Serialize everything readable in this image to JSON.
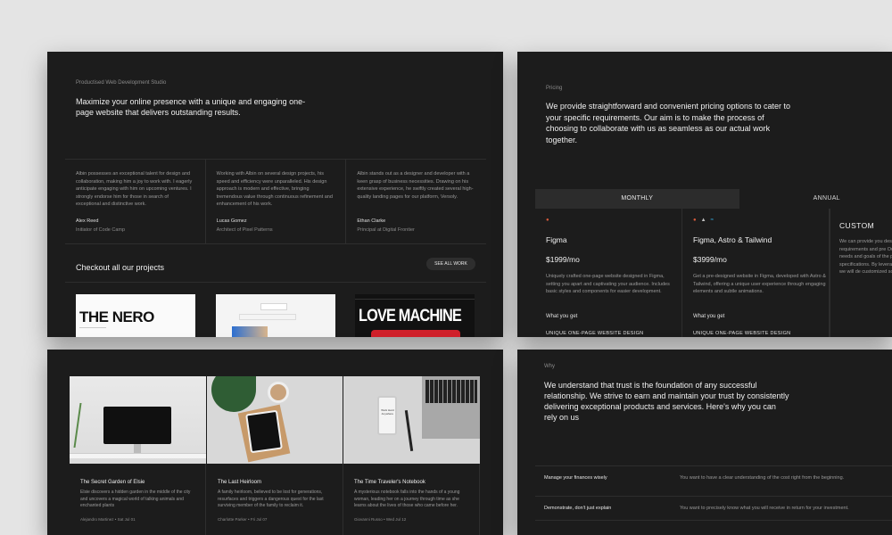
{
  "hero": {
    "eyebrow": "Productised Web Development Studio",
    "headline": "Maximize your online presence with a unique and engaging one-page website that delivers outstanding results."
  },
  "testimonials": [
    {
      "quote": "Albin possesses an exceptional talent for design and collaboration, making him a joy to work with. I eagerly anticipate engaging with him on upcoming ventures. I strongly endorse him for those in search of exceptional and distinctive work.",
      "name": "Alex Reed",
      "role": "Initiator of Code Camp"
    },
    {
      "quote": "Working with Albin on several design projects, his speed and efficiency were unparalleled. His design approach is modern and effective, bringing tremendous value through continuous refinement and enhancement of his work.",
      "name": "Lucas Gomez",
      "role": "Architect of Pixel Patterns"
    },
    {
      "quote": "Albin stands out as a designer and developer with a keen grasp of business necessities. Drawing on his extensive experience, he swiftly created several high-quality landing pages for our platform, Versoly.",
      "name": "Ethan Clarke",
      "role": "Principal at Digital Frontier"
    }
  ],
  "projects": {
    "title": "Checkout all our projects",
    "see_all_label": "SEE ALL WORK",
    "thumbs": [
      {
        "text": "THE NERO"
      },
      {
        "text": ""
      },
      {
        "text": "LOVE MACHINE"
      }
    ]
  },
  "pricing": {
    "eyebrow": "Pricing",
    "headline": "We provide straightforward and convenient pricing options to cater to your specific requirements. Our aim is to make the process of choosing to collaborate with us as seamless as our actual work together.",
    "tabs": [
      {
        "label": "MONTHLY",
        "active": true
      },
      {
        "label": "ANNUAL",
        "active": false
      }
    ],
    "plans": [
      {
        "name": "Figma",
        "price": "$1999/mo",
        "desc": "Uniquely crafted one-page website designed in Figma, setting you apart and captivating your audience. Includes basic styles and components for easier development.",
        "get_label": "What you get",
        "feature": "UNIQUE ONE-PAGE WEBSITE DESIGN",
        "icons": [
          "figma-icon"
        ]
      },
      {
        "name": "Figma, Astro & Tailwind",
        "price": "$3999/mo",
        "desc": "Get a pre-designed website in Figma, developed with Astro & Tailwind, offering a unique user experience through engaging elements and subtle animations.",
        "get_label": "What you get",
        "feature": "UNIQUE ONE-PAGE WEBSITE DESIGN",
        "icons": [
          "figma-icon",
          "astro-icon",
          "tailwind-icon"
        ]
      },
      {
        "name": "CUSTOM",
        "desc": "We can provide you designed specifically requirements and pre Our team will work c your needs and goals of the package is per your specifications. By leveraging our exp resources, we will de customized solution"
      }
    ],
    "colors": {
      "figma": "#d75a3b",
      "tailwind": "#38bdf8"
    }
  },
  "posts": [
    {
      "title": "The Secret Garden of Elsie",
      "excerpt": "Elsie discovers a hidden garden in the middle of the city and uncovers a magical world of talking animals and enchanted plants",
      "meta": "Alejandro Martinez • Sat Jul 01"
    },
    {
      "title": "The Last Heirloom",
      "excerpt": "A family heirloom, believed to be lost for generations, resurfaces and triggers a dangerous quest for the last surviving member of the family to reclaim it.",
      "meta": "Charlotte Parker • Fri Jul 07"
    },
    {
      "title": "The Time Traveler's Notebook",
      "excerpt": "A mysterious notebook falls into the hands of a young woman, leading her on a journey through time as she learns about the lives of those who came before her.",
      "meta": "Giovanni Russo • Wed Jul 12"
    }
  ],
  "phone_note": "Work Hard Anywhere",
  "why": {
    "eyebrow": "Why",
    "headline": "We understand that trust is the foundation of any successful relationship. We strive to earn and maintain your trust by consistently delivering exceptional products and services. Here's why you can rely on us",
    "rows": [
      {
        "key": "Manage your finances wisely",
        "value": "You want to have a clear understanding of the cost right from the beginning."
      },
      {
        "key": "Demonstrate, don't just explain",
        "value": "You want to precisely know what you will receive in return for your investment."
      }
    ]
  }
}
